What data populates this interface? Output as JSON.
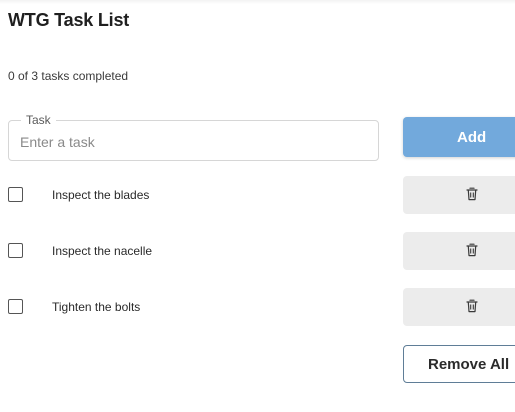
{
  "app": {
    "title": "WTG Task List",
    "progress_text": "0 of 3 tasks completed"
  },
  "task_input": {
    "label": "Task",
    "placeholder": "Enter a task",
    "value": ""
  },
  "buttons": {
    "add_label": "Add",
    "remove_all_label": "Remove All",
    "delete_icon": "trash-icon"
  },
  "tasks": [
    {
      "text": "Inspect the blades",
      "completed": false
    },
    {
      "text": "Inspect the nacelle",
      "completed": false
    },
    {
      "text": "Tighten the bolts",
      "completed": false
    }
  ],
  "colors": {
    "accent": "#72a9dc",
    "delete_button_bg": "#ececec",
    "remove_all_border": "#5f7d97"
  }
}
